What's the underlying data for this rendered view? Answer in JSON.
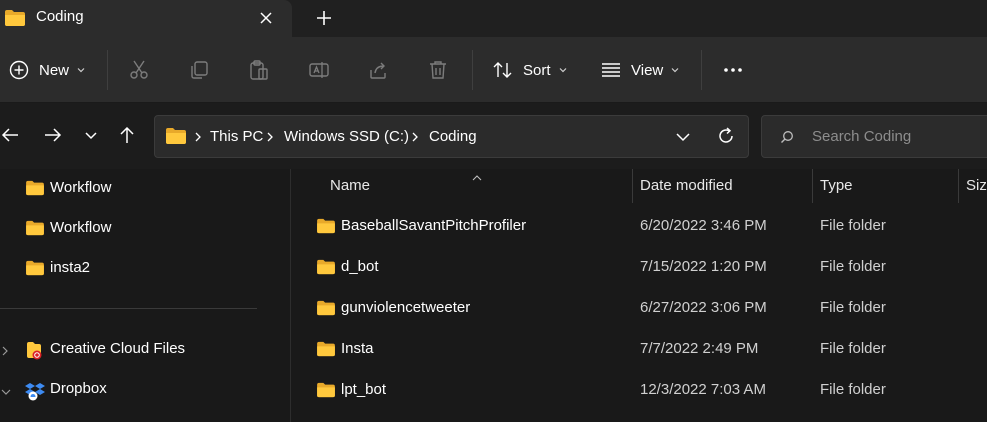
{
  "tab": {
    "title": "Coding"
  },
  "toolbar": {
    "new_label": "New",
    "sort_label": "Sort",
    "view_label": "View",
    "more": "•••"
  },
  "address": {
    "crumbs": [
      "This PC",
      "Windows SSD (C:)",
      "Coding"
    ]
  },
  "search": {
    "placeholder": "Search Coding"
  },
  "nav": {
    "items": [
      {
        "label": "Workflow",
        "icon": "folder-icon"
      },
      {
        "label": "Workflow",
        "icon": "folder-icon"
      },
      {
        "label": "insta2",
        "icon": "folder-icon"
      },
      {
        "label": "Creative Cloud Files",
        "icon": "creative-cloud-icon"
      },
      {
        "label": "Dropbox",
        "icon": "dropbox-icon"
      }
    ]
  },
  "columns": {
    "name": "Name",
    "date": "Date modified",
    "type": "Type",
    "size": "Siz"
  },
  "files": [
    {
      "name": "BaseballSavantPitchProfiler",
      "date": "6/20/2022 3:46 PM",
      "type": "File folder"
    },
    {
      "name": "d_bot",
      "date": "7/15/2022 1:20 PM",
      "type": "File folder"
    },
    {
      "name": "gunviolencetweeter",
      "date": "6/27/2022 3:06 PM",
      "type": "File folder"
    },
    {
      "name": "Insta",
      "date": "7/7/2022 2:49 PM",
      "type": "File folder"
    },
    {
      "name": "lpt_bot",
      "date": "12/3/2022 7:03 AM",
      "type": "File folder"
    }
  ],
  "colors": {
    "folder": "#ffc83d",
    "folder_back": "#e8a92a",
    "background": "#191919",
    "toolbar": "#2c2c2c"
  }
}
